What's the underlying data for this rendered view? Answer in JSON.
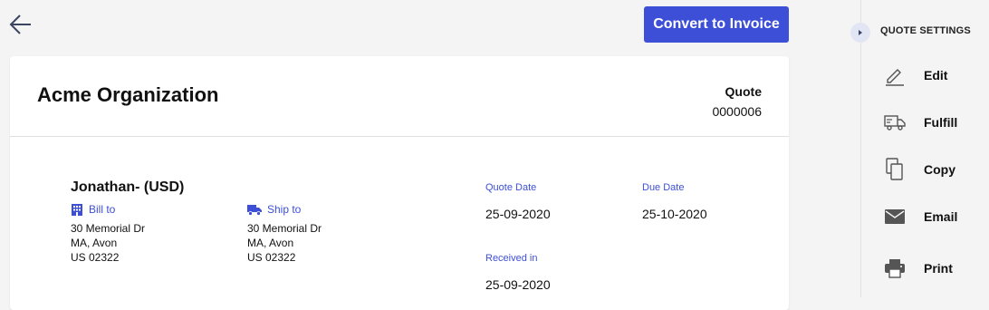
{
  "header": {
    "convert_label": "Convert to Invoice"
  },
  "document": {
    "organization": "Acme Organization",
    "type": "Quote",
    "number": "0000006",
    "customer": "Jonathan- (USD)",
    "bill_to": {
      "label": "Bill to",
      "lines": [
        "30 Memorial Dr",
        "MA, Avon",
        "US 02322"
      ]
    },
    "ship_to": {
      "label": "Ship to",
      "lines": [
        "30 Memorial Dr",
        "MA, Avon",
        "US 02322"
      ]
    },
    "quote_date": {
      "label": "Quote Date",
      "value": "25-09-2020"
    },
    "due_date": {
      "label": "Due Date",
      "value": "25-10-2020"
    },
    "received_in": {
      "label": "Received in",
      "value": "25-09-2020"
    }
  },
  "sidebar": {
    "title": "QUOTE SETTINGS",
    "actions": [
      {
        "label": "Edit",
        "icon": "pencil-icon"
      },
      {
        "label": "Fulfill",
        "icon": "truck-icon"
      },
      {
        "label": "Copy",
        "icon": "copy-icon"
      },
      {
        "label": "Email",
        "icon": "envelope-icon"
      },
      {
        "label": "Print",
        "icon": "printer-icon"
      }
    ]
  },
  "colors": {
    "accent": "#3d4fd6",
    "background": "#f4f4f4",
    "icon": "#555555"
  }
}
